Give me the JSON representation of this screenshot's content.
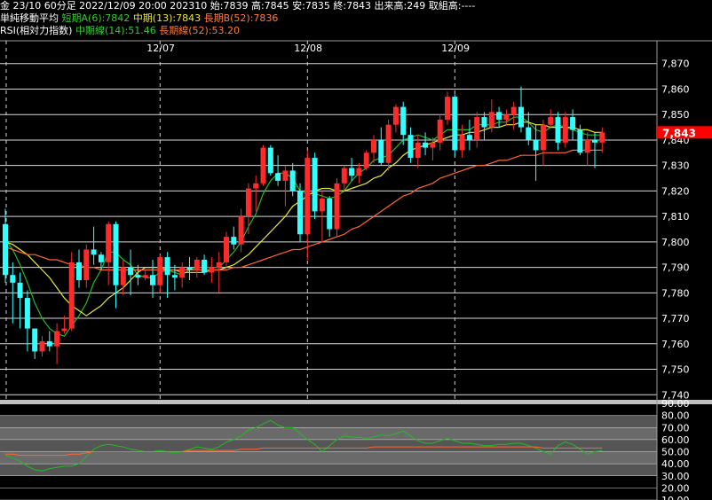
{
  "header": {
    "line1": "金 23/10 60分足 2022/12/09 20:00 202310 始:7839 高:7845 安:7835 終:7843 出来高:249 取組高:----",
    "ma_title": "単純移動平均",
    "ma_a": "短期A(6):7842",
    "ma_b": "中期(13):7843",
    "ma_c": "長期B(52):7836",
    "rsi_title": "RSI(相対力指数)",
    "rsi_mid": "中期線(14):51.46",
    "rsi_long": "長期線(52):53.20"
  },
  "colors": {
    "up": "#ff2a2a",
    "down": "#33ffff",
    "ma_short": "#22bb22",
    "ma_mid": "#e8e83a",
    "ma_long": "#ff6633",
    "price_tag": "#ff0000"
  },
  "chart_data": [
    {
      "type": "candlestick",
      "x_labels": [
        "12/07",
        "12/08",
        "12/09"
      ],
      "x_label_positions": [
        21,
        41,
        61
      ],
      "y_ticks": [
        "7,870",
        "7,860",
        "7,850",
        "7,840",
        "7,830",
        "7,820",
        "7,810",
        "7,800",
        "7,790",
        "7,780",
        "7,770",
        "7,760",
        "7,750",
        "7,740"
      ],
      "ylim": [
        7738,
        7872
      ],
      "last_price": "7,843",
      "last_value": 7843,
      "candles": [
        [
          7807,
          7813,
          7784,
          7787
        ],
        [
          7787,
          7792,
          7768,
          7784
        ],
        [
          7784,
          7788,
          7766,
          7778
        ],
        [
          7778,
          7781,
          7757,
          7766
        ],
        [
          7766,
          7766,
          7754,
          7757
        ],
        [
          7757,
          7763,
          7755,
          7761
        ],
        [
          7761,
          7765,
          7757,
          7759
        ],
        [
          7759,
          7768,
          7752,
          7765
        ],
        [
          7765,
          7771,
          7764,
          7766
        ],
        [
          7766,
          7796,
          7765,
          7792
        ],
        [
          7792,
          7797,
          7782,
          7785
        ],
        [
          7785,
          7799,
          7782,
          7797
        ],
        [
          7797,
          7806,
          7791,
          7795
        ],
        [
          7795,
          7796,
          7789,
          7792
        ],
        [
          7792,
          7808,
          7783,
          7807
        ],
        [
          7807,
          7808,
          7774,
          7783
        ],
        [
          7783,
          7793,
          7779,
          7790
        ],
        [
          7790,
          7797,
          7779,
          7787
        ],
        [
          7787,
          7791,
          7783,
          7786
        ],
        [
          7786,
          7789,
          7785,
          7787
        ],
        [
          7787,
          7793,
          7778,
          7783
        ],
        [
          7783,
          7795,
          7780,
          7794
        ],
        [
          7794,
          7796,
          7778,
          7787
        ],
        [
          7787,
          7791,
          7781,
          7786
        ],
        [
          7786,
          7792,
          7782,
          7790
        ],
        [
          7790,
          7794,
          7785,
          7789
        ],
        [
          7789,
          7794,
          7786,
          7793
        ],
        [
          7793,
          7795,
          7787,
          7788
        ],
        [
          7788,
          7794,
          7784,
          7790
        ],
        [
          7790,
          7796,
          7780,
          7792
        ],
        [
          7792,
          7804,
          7790,
          7802
        ],
        [
          7802,
          7806,
          7797,
          7799
        ],
        [
          7799,
          7813,
          7796,
          7810
        ],
        [
          7810,
          7823,
          7803,
          7821
        ],
        [
          7821,
          7826,
          7812,
          7823
        ],
        [
          7823,
          7838,
          7822,
          7837
        ],
        [
          7837,
          7838,
          7826,
          7827
        ],
        [
          7827,
          7834,
          7822,
          7824
        ],
        [
          7824,
          7830,
          7814,
          7828
        ],
        [
          7828,
          7831,
          7818,
          7820
        ],
        [
          7820,
          7823,
          7800,
          7803
        ],
        [
          7803,
          7836,
          7793,
          7833
        ],
        [
          7833,
          7835,
          7809,
          7812
        ],
        [
          7812,
          7820,
          7800,
          7817
        ],
        [
          7817,
          7818,
          7802,
          7805
        ],
        [
          7805,
          7825,
          7802,
          7823
        ],
        [
          7823,
          7830,
          7820,
          7829
        ],
        [
          7829,
          7833,
          7824,
          7826
        ],
        [
          7826,
          7831,
          7823,
          7829
        ],
        [
          7829,
          7836,
          7828,
          7835
        ],
        [
          7835,
          7842,
          7831,
          7840
        ],
        [
          7840,
          7845,
          7830,
          7831
        ],
        [
          7831,
          7848,
          7828,
          7846
        ],
        [
          7846,
          7854,
          7843,
          7853
        ],
        [
          7853,
          7855,
          7838,
          7842
        ],
        [
          7842,
          7845,
          7831,
          7833
        ],
        [
          7833,
          7842,
          7829,
          7839
        ],
        [
          7839,
          7843,
          7834,
          7837
        ],
        [
          7837,
          7841,
          7832,
          7839
        ],
        [
          7839,
          7850,
          7836,
          7848
        ],
        [
          7848,
          7859,
          7846,
          7857
        ],
        [
          7857,
          7858,
          7834,
          7836
        ],
        [
          7836,
          7846,
          7833,
          7842
        ],
        [
          7842,
          7848,
          7836,
          7840
        ],
        [
          7840,
          7851,
          7837,
          7849
        ],
        [
          7849,
          7851,
          7840,
          7845
        ],
        [
          7845,
          7856,
          7843,
          7851
        ],
        [
          7851,
          7853,
          7845,
          7848
        ],
        [
          7848,
          7852,
          7846,
          7850
        ],
        [
          7850,
          7855,
          7844,
          7853
        ],
        [
          7853,
          7861,
          7843,
          7845
        ],
        [
          7845,
          7851,
          7838,
          7840
        ],
        [
          7840,
          7846,
          7824,
          7836
        ],
        [
          7836,
          7848,
          7830,
          7846
        ],
        [
          7846,
          7852,
          7845,
          7849
        ],
        [
          7849,
          7851,
          7836,
          7839
        ],
        [
          7839,
          7851,
          7837,
          7849
        ],
        [
          7849,
          7852,
          7840,
          7844
        ],
        [
          7844,
          7846,
          7834,
          7835
        ],
        [
          7835,
          7843,
          7830,
          7840
        ],
        [
          7840,
          7843,
          7829,
          7839
        ],
        [
          7839,
          7845,
          7835,
          7843
        ]
      ],
      "series": [
        {
          "name": "短期A(6)",
          "values": [
            7801,
            7797,
            7791,
            7784,
            7776,
            7770,
            7766,
            7764,
            7763,
            7767,
            7771,
            7776,
            7784,
            7789,
            7796,
            7796,
            7793,
            7791,
            7787,
            7786,
            7786,
            7788,
            7789,
            7788,
            7787,
            7789,
            7790,
            7790,
            7790,
            7790,
            7793,
            7796,
            7800,
            7806,
            7811,
            7819,
            7824,
            7827,
            7827,
            7825,
            7820,
            7819,
            7819,
            7818,
            7817,
            7818,
            7820,
            7824,
            7827,
            7829,
            7832,
            7833,
            7834,
            7837,
            7840,
            7841,
            7842,
            7841,
            7840,
            7842,
            7844,
            7844,
            7844,
            7844,
            7846,
            7846,
            7846,
            7847,
            7847,
            7849,
            7849,
            7847,
            7844,
            7843,
            7845,
            7846,
            7845,
            7844,
            7843,
            7842,
            7842,
            7842
          ]
        },
        {
          "name": "中期(13)",
          "values": [
            7800,
            7799,
            7797,
            7795,
            7792,
            7789,
            7786,
            7782,
            7778,
            7775,
            7773,
            7771,
            7773,
            7775,
            7778,
            7780,
            7782,
            7785,
            7788,
            7790,
            7790,
            7790,
            7789,
            7789,
            7788,
            7788,
            7788,
            7788,
            7789,
            7789,
            7790,
            7791,
            7793,
            7795,
            7798,
            7801,
            7804,
            7807,
            7810,
            7814,
            7816,
            7818,
            7820,
            7821,
            7821,
            7820,
            7820,
            7821,
            7822,
            7823,
            7825,
            7826,
            7829,
            7831,
            7834,
            7836,
            7837,
            7838,
            7839,
            7840,
            7841,
            7842,
            7842,
            7843,
            7843,
            7844,
            7845,
            7845,
            7846,
            7846,
            7847,
            7847,
            7846,
            7846,
            7845,
            7845,
            7845,
            7845,
            7844,
            7844,
            7843,
            7843
          ]
        },
        {
          "name": "長期B(52)",
          "values": [
            7798,
            7797,
            7796,
            7795,
            7795,
            7794,
            7793,
            7793,
            7792,
            7791,
            7791,
            7790,
            7790,
            7789,
            7789,
            7789,
            7789,
            7789,
            7789,
            7789,
            7789,
            7789,
            7789,
            7789,
            7789,
            7789,
            7789,
            7789,
            7789,
            7789,
            7789,
            7790,
            7790,
            7791,
            7792,
            7793,
            7794,
            7795,
            7796,
            7797,
            7797,
            7798,
            7799,
            7800,
            7801,
            7802,
            7803,
            7805,
            7806,
            7808,
            7810,
            7812,
            7814,
            7816,
            7818,
            7819,
            7821,
            7822,
            7823,
            7825,
            7826,
            7827,
            7828,
            7829,
            7830,
            7830,
            7831,
            7832,
            7832,
            7833,
            7834,
            7834,
            7834,
            7835,
            7835,
            7835,
            7835,
            7836,
            7836,
            7836,
            7836,
            7836
          ]
        }
      ]
    },
    {
      "type": "line",
      "title": "RSI",
      "y_ticks": [
        "90.00",
        "80.00",
        "70.00",
        "60.00",
        "50.00",
        "40.00",
        "30.00",
        "20.00",
        "10.00"
      ],
      "ylim": [
        10,
        90
      ],
      "bands": [
        [
          20,
          30
        ],
        [
          30,
          40
        ],
        [
          40,
          50
        ],
        [
          50,
          60
        ],
        [
          60,
          70
        ],
        [
          70,
          80
        ]
      ],
      "series": [
        {
          "name": "中期線(14)",
          "values": [
            47,
            45,
            42,
            38,
            35,
            34,
            36,
            37,
            38,
            38,
            40,
            46,
            52,
            55,
            56,
            55,
            54,
            52,
            51,
            50,
            50,
            51,
            50,
            49,
            50,
            52,
            54,
            53,
            52,
            54,
            58,
            60,
            63,
            68,
            70,
            73,
            76,
            72,
            70,
            70,
            65,
            60,
            56,
            50,
            55,
            60,
            63,
            62,
            62,
            61,
            62,
            64,
            63,
            65,
            67,
            63,
            59,
            57,
            57,
            59,
            61,
            59,
            57,
            57,
            56,
            55,
            55,
            56,
            56,
            57,
            57,
            55,
            53,
            50,
            48,
            55,
            58,
            56,
            52,
            48,
            50,
            51
          ]
        },
        {
          "name": "長期線(52)",
          "values": [
            48,
            48,
            47,
            47,
            47,
            47,
            47,
            47,
            47,
            48,
            48,
            49,
            50,
            50,
            50,
            50,
            50,
            50,
            50,
            50,
            50,
            50,
            50,
            50,
            50,
            51,
            51,
            51,
            51,
            51,
            51,
            51,
            52,
            52,
            52,
            53,
            53,
            53,
            53,
            53,
            53,
            53,
            53,
            53,
            53,
            53,
            53,
            53,
            53,
            53,
            54,
            54,
            54,
            54,
            54,
            54,
            54,
            54,
            54,
            54,
            54,
            54,
            54,
            54,
            54,
            54,
            54,
            54,
            54,
            54,
            54,
            54,
            54,
            53,
            53,
            53,
            53,
            53,
            53,
            53,
            53,
            53
          ]
        }
      ]
    }
  ]
}
